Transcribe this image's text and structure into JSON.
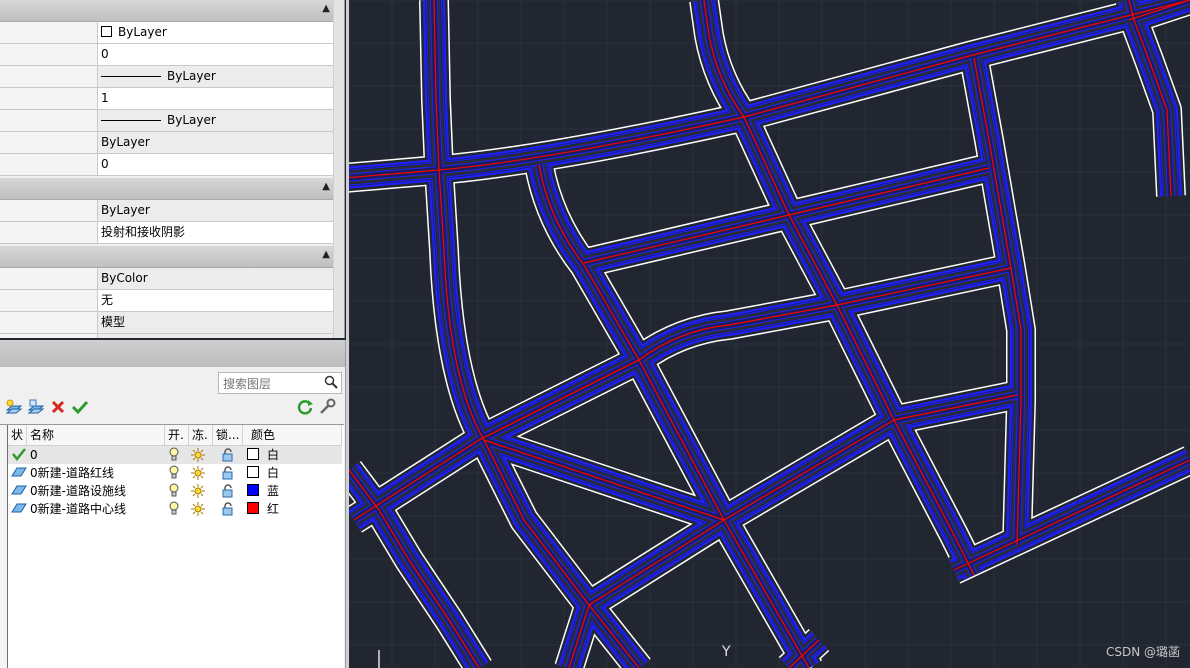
{
  "properties": {
    "section1": [
      {
        "value": "ByLayer",
        "kind": "color"
      },
      {
        "value": "0"
      },
      {
        "value": "ByLayer",
        "kind": "linetype"
      },
      {
        "value": "1"
      },
      {
        "value": "ByLayer",
        "kind": "lineweight"
      },
      {
        "value": "ByLayer"
      },
      {
        "value": "0"
      }
    ],
    "section2": [
      {
        "value": "ByLayer"
      },
      {
        "value": "投射和接收阴影"
      }
    ],
    "section3": [
      {
        "value": "ByColor"
      },
      {
        "value": "无"
      },
      {
        "value": "模型"
      }
    ]
  },
  "layers": {
    "search_placeholder": "搜索图层",
    "columns": {
      "status": "状",
      "name": "名称",
      "on": "开.",
      "freeze": "冻.",
      "lock": "锁...",
      "color": "颜色"
    },
    "rows": [
      {
        "name": "0",
        "color_name": "白",
        "color": "#ffffff",
        "current": true
      },
      {
        "name": "0新建-道路红线",
        "color_name": "白",
        "color": "#ffffff",
        "current": false
      },
      {
        "name": "0新建-道路设施线",
        "color_name": "蓝",
        "color": "#0000ff",
        "current": false
      },
      {
        "name": "0新建-道路中心线",
        "color_name": "红",
        "color": "#ff0000",
        "current": false
      }
    ]
  },
  "canvas": {
    "background": "#212630",
    "colors": {
      "edge": "#ffffff",
      "facility": "#2020ff",
      "center": "#ff0000"
    },
    "ucs_label": "Y",
    "watermark": "CSDN @璐菡"
  }
}
